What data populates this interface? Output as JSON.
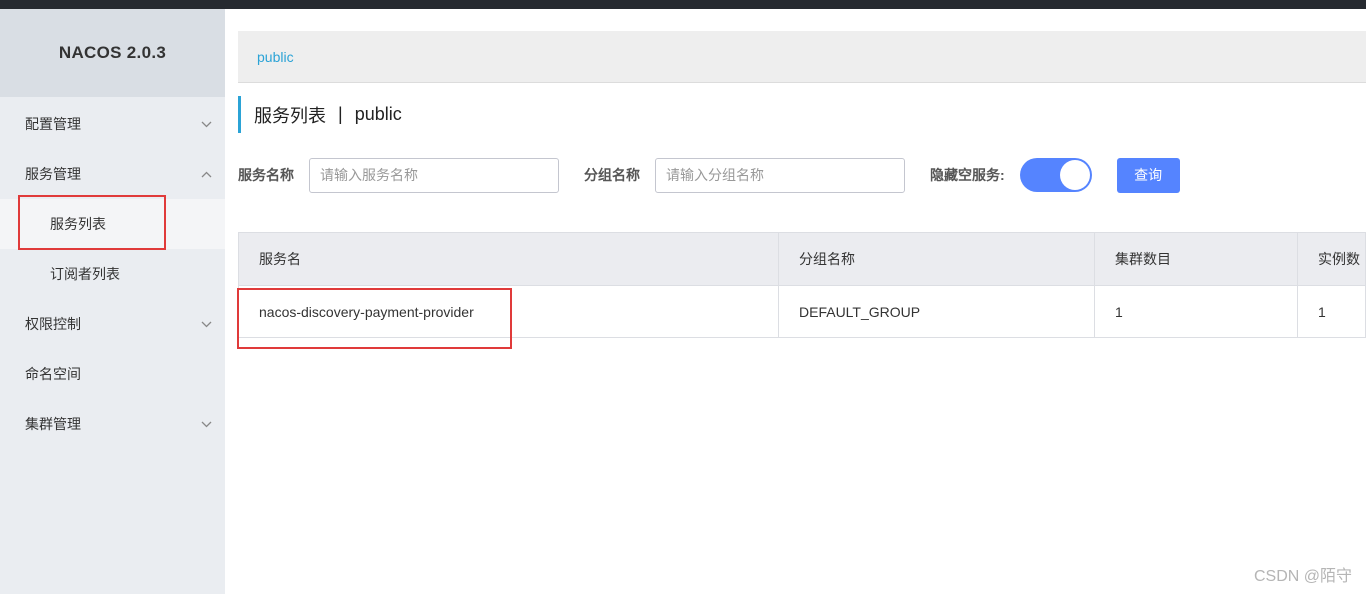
{
  "app": {
    "logo": "NACOS 2.0.3"
  },
  "sidebar": {
    "items": [
      {
        "label": "配置管理",
        "chevron": "down"
      },
      {
        "label": "服务管理",
        "chevron": "up",
        "children": [
          {
            "label": "服务列表",
            "active": true
          },
          {
            "label": "订阅者列表",
            "active": false
          }
        ]
      },
      {
        "label": "权限控制",
        "chevron": "down"
      },
      {
        "label": "命名空间",
        "chevron": ""
      },
      {
        "label": "集群管理",
        "chevron": "down"
      }
    ]
  },
  "breadcrumb": {
    "namespace": "public"
  },
  "page": {
    "title": "服务列表",
    "separator": "|",
    "namespace": "public"
  },
  "filters": {
    "service_name_label": "服务名称",
    "service_name_placeholder": "请输入服务名称",
    "group_name_label": "分组名称",
    "group_name_placeholder": "请输入分组名称",
    "hide_empty_label": "隐藏空服务:",
    "hide_empty_enabled": true,
    "query_button": "查询"
  },
  "table": {
    "headers": [
      "服务名",
      "分组名称",
      "集群数目",
      "实例数"
    ],
    "rows": [
      [
        "nacos-discovery-payment-provider",
        "DEFAULT_GROUP",
        "1",
        "1"
      ]
    ]
  },
  "watermark": "CSDN @陌守",
  "colors": {
    "accent": "#5584ff",
    "link": "#2ba3d6",
    "highlight": "#e03a3a",
    "sidebar_bg": "#eaedf1"
  }
}
